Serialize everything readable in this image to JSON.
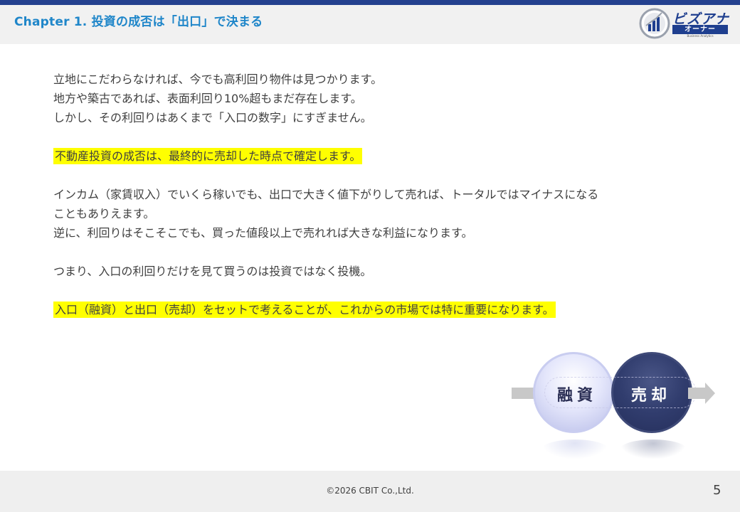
{
  "header": {
    "chapter_title": "Chapter 1. 投資の成否は「出口」で決まる",
    "logo": {
      "name": "ビズアナ",
      "bar_text": "オーナー",
      "subtitle": "Business Analytics"
    }
  },
  "body": {
    "paragraphs": [
      [
        "立地にこだわらなければ、今でも高利回り物件は見つかります。",
        "地方や築古であれば、表面利回り10%超もまだ存在します。",
        "しかし、その利回りはあくまで「入口の数字」にすぎません。"
      ],
      [
        "不動産投資の成否は、最終的に売却した時点で確定します。"
      ],
      [
        "インカム（家賃収入）でいくら稼いでも、出口で大きく値下がりして売れば、トータルではマイナスになる",
        "こともありえます。",
        "逆に、利回りはそこそこでも、買った値段以上で売れれば大きな利益になります。"
      ],
      [
        "つまり、入口の利回りだけを見て買うのは投資ではなく投機。"
      ],
      [
        "入口（融資）と出口（売却）をセットで考えることが、これからの市場では特に重要になります。"
      ]
    ]
  },
  "diagram": {
    "left_label": "融資",
    "right_label": "売却",
    "colors": {
      "left": "#e4e6fb",
      "right": "#2f3a6b",
      "arrow": "#c8c8c8"
    }
  },
  "footer": {
    "copyright": "©2026 CBIT Co.,Ltd.",
    "page_number": "5"
  },
  "colors": {
    "accent": "#1f86c9",
    "brand": "#24418f",
    "highlight": "#ffff00"
  }
}
